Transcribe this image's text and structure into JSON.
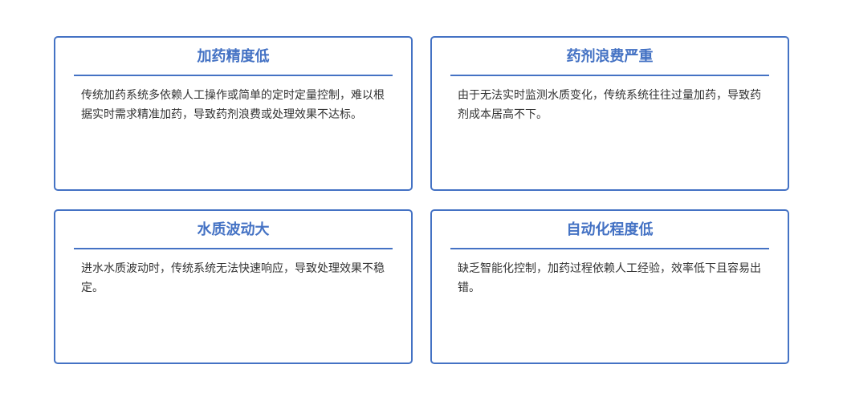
{
  "cards": [
    {
      "title": "加药精度低",
      "body": "传统加药系统多依赖人工操作或简单的定时定量控制，难以根据实时需求精准加药，导致药剂浪费或处理效果不达标。"
    },
    {
      "title": "药剂浪费严重",
      "body": "由于无法实时监测水质变化，传统系统往往过量加药，导致药剂成本居高不下。"
    },
    {
      "title": "水质波动大",
      "body": "进水水质波动时，传统系统无法快速响应，导致处理效果不稳定。"
    },
    {
      "title": "自动化程度低",
      "body": "缺乏智能化控制，加药过程依赖人工经验，效率低下且容易出错。"
    }
  ],
  "colors": {
    "accent": "#4472c4",
    "text": "#333333",
    "background": "#ffffff"
  }
}
